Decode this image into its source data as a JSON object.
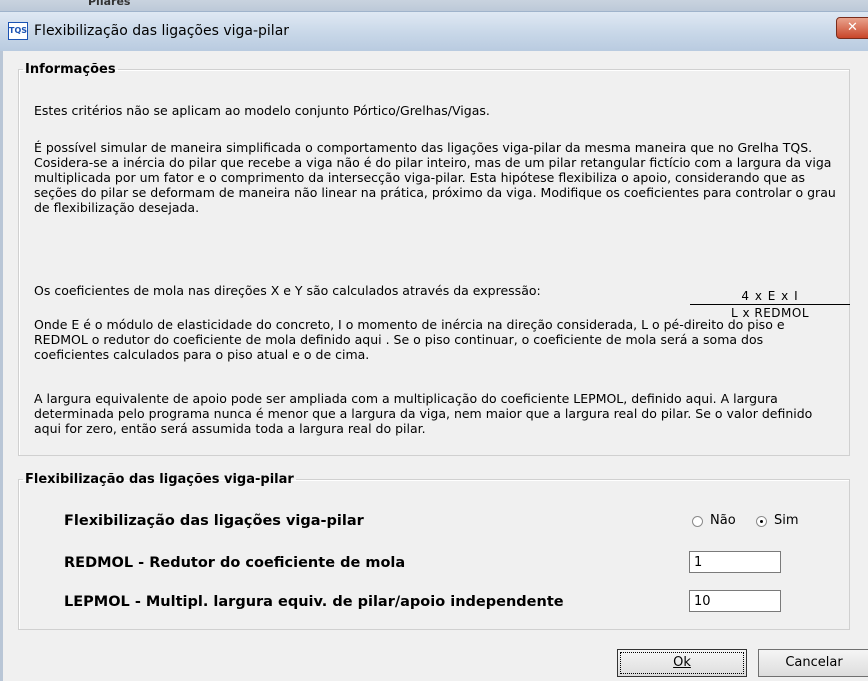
{
  "window": {
    "behind_title": "Pilares",
    "app_icon": "TQS",
    "title": "Flexibilização das ligações viga-pilar",
    "close_glyph": "✕"
  },
  "info": {
    "legend": "Informações",
    "p1": "Estes critérios não se aplicam ao modelo conjunto Pórtico/Grelhas/Vigas.",
    "p2": "É possível simular de maneira simplificada o comportamento das ligações viga-pilar da mesma maneira que no Grelha TQS. Cosidera-se a inércia do pilar que recebe a viga não é do pilar inteiro, mas de um pilar retangular fictício com a largura da viga multiplicada por um fator e o comprimento da intersecção viga-pilar. Esta hipótese flexibiliza o apoio, considerando que as seções do pilar se deformam de maneira não linear na prática, próximo da viga. Modifique os coeficientes para controlar o grau de flexibilização desejada.",
    "p3": "Os coeficientes de mola nas direções X e Y são calculados através da expressão:",
    "formula_numerator": "4 x E x I",
    "formula_denominator": "L x REDMOL",
    "p4": "Onde E é o módulo de elasticidade do concreto, I o momento de inércia na direção considerada, L o pé-direito do piso e REDMOL o redutor do coeficiente de mola definido aqui . Se o piso continuar, o coeficiente de mola será a soma dos coeficientes calculados para o piso atual e o de cima.",
    "p5": "A largura equivalente de apoio pode ser ampliada com a multiplicação do coeficiente LEPMOL, definido aqui. A largura determinada pelo programa nunca é menor que a largura da viga, nem maior que a largura real do pilar. Se o valor definido aqui for zero, então será assumida toda a largura real do pilar."
  },
  "flex": {
    "legend": "Flexibilização das ligações viga-pilar",
    "row1_label": "Flexibilização das ligações viga-pilar",
    "option_no": "Não",
    "option_yes": "Sim",
    "selected": "Sim",
    "row2_label": "REDMOL - Redutor do coeficiente de mola",
    "redmol_value": "1",
    "row3_label": "LEPMOL - Multipl. largura equiv. de pilar/apoio independente",
    "lepmol_value": "10"
  },
  "buttons": {
    "ok": "Ok",
    "cancel": "Cancelar"
  }
}
